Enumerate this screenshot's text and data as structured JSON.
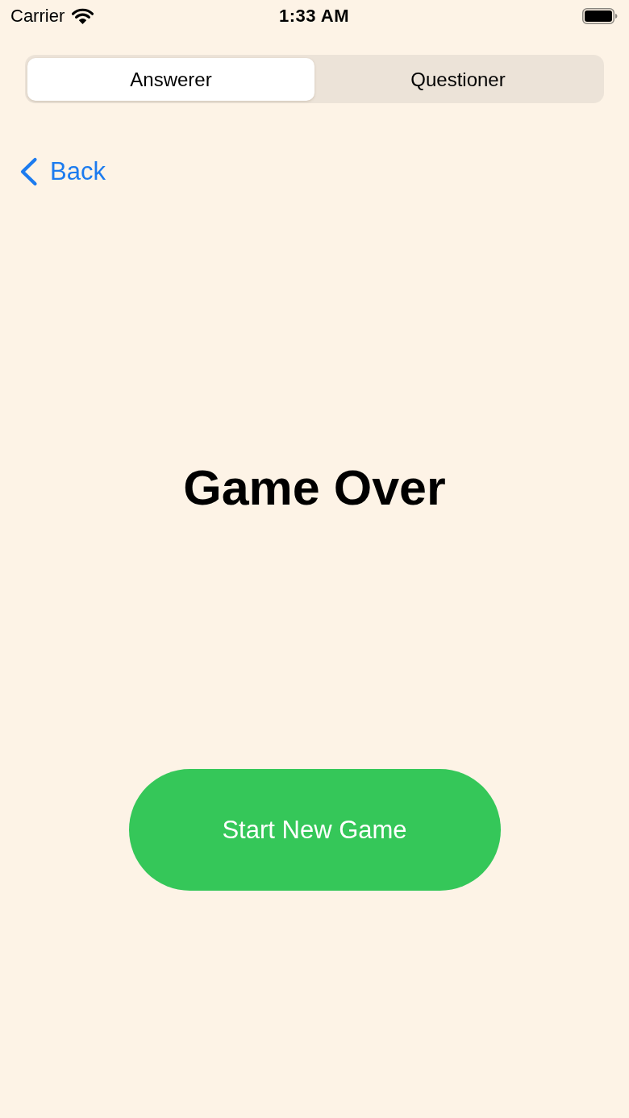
{
  "status_bar": {
    "carrier": "Carrier",
    "time": "1:33 AM"
  },
  "segments": [
    {
      "label": "Answerer",
      "selected": true
    },
    {
      "label": "Questioner",
      "selected": false
    }
  ],
  "back_button": {
    "label": "Back"
  },
  "title": "Game Over",
  "primary_button": {
    "label": "Start New Game"
  }
}
